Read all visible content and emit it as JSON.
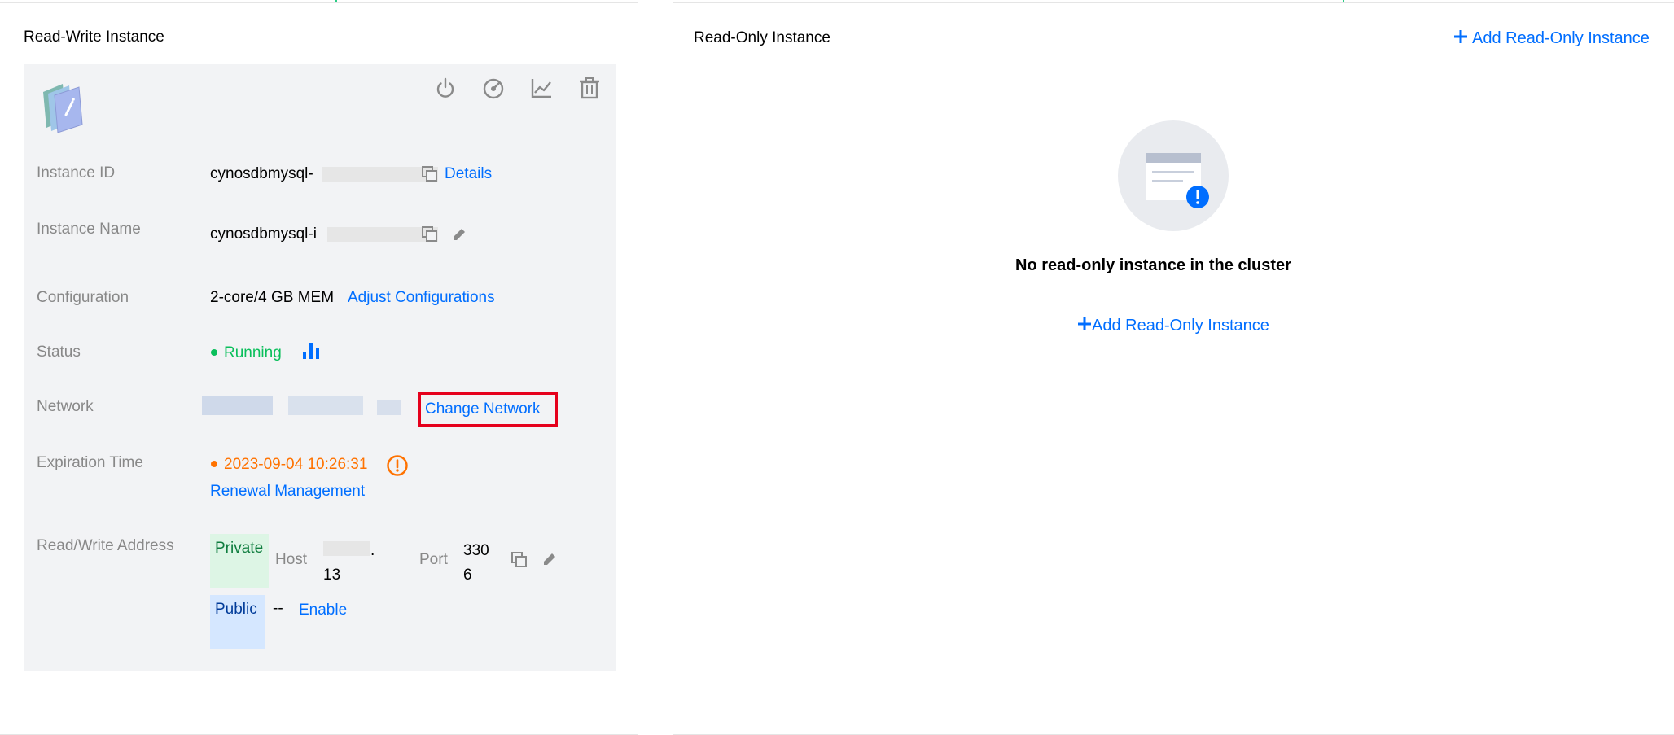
{
  "left_panel": {
    "title": "Read-Write Instance",
    "fields": {
      "instance_id": {
        "label": "Instance ID",
        "value": "cynosdbmysql-",
        "details_link": "Details"
      },
      "instance_name": {
        "label": "Instance Name",
        "value": "cynosdbmysql-i"
      },
      "configuration": {
        "label": "Configuration",
        "value": "2-core/4 GB MEM",
        "adjust_link": "Adjust Configurations"
      },
      "status": {
        "label": "Status",
        "value": "Running",
        "color": "#0abf5b"
      },
      "network": {
        "label": "Network",
        "change_link": "Change Network"
      },
      "expiration": {
        "label": "Expiration Time",
        "value": "2023-09-04 10:26:31",
        "color": "#ff7200",
        "renewal_link": "Renewal Management"
      },
      "address": {
        "label": "Read/Write Address",
        "private_tag": "Private",
        "host_label": "Host",
        "host_value": ".13",
        "port_label": "Port",
        "port_value": "3306",
        "public_tag": "Public",
        "public_value": "--",
        "enable_link": "Enable"
      }
    },
    "toolbar_icons": [
      "power-icon",
      "speed-icon",
      "line-chart-icon",
      "trash-icon"
    ]
  },
  "right_panel": {
    "title": "Read-Only Instance",
    "add_link": "Add Read-Only Instance",
    "empty_text": "No read-only instance in the cluster",
    "empty_add_link": "Add Read-Only Instance"
  },
  "colors": {
    "link": "#006eff",
    "highlight_box": "#e5001c"
  }
}
